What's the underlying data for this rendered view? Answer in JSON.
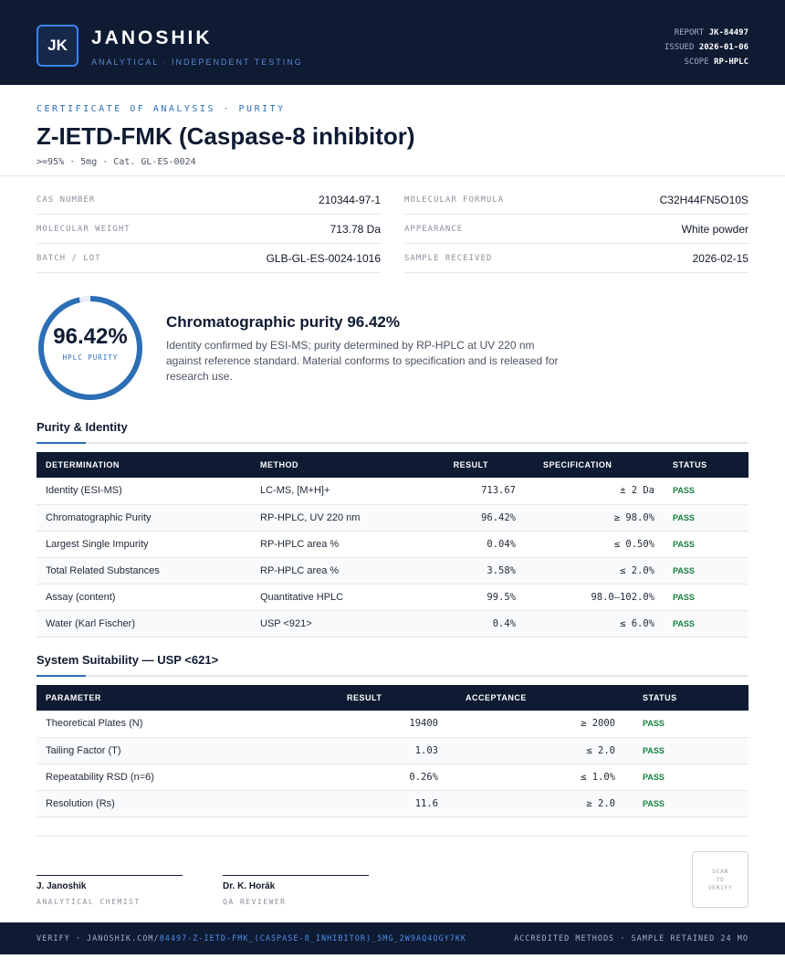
{
  "header": {
    "logo": "JK",
    "brand": "JANOSHIK",
    "tagline": "ANALYTICAL · INDEPENDENT TESTING",
    "report_label": "REPORT",
    "report_value": "JK-84497",
    "issued_label": "ISSUED",
    "issued_value": "2026-01-06",
    "scope_label": "SCOPE",
    "scope_value": "RP-HPLC"
  },
  "doc": {
    "eyebrow": "CERTIFICATE OF ANALYSIS · PURITY",
    "title": "Z-IETD-FMK (Caspase-8 inhibitor)",
    "subline": ">=95% · 5mg  ·  Cat. GL-ES-0024"
  },
  "meta": {
    "cas_label": "CAS NUMBER",
    "cas_value": "210344-97-1",
    "formula_label": "MOLECULAR FORMULA",
    "formula_value": "C32H44FN5O10S",
    "mw_label": "MOLECULAR WEIGHT",
    "mw_value": "713.78 Da",
    "appearance_label": "APPEARANCE",
    "appearance_value": "White powder",
    "batch_label": "BATCH / LOT",
    "batch_value": "GLB-GL-ES-0024-1016",
    "received_label": "SAMPLE RECEIVED",
    "received_value": "2026-02-15"
  },
  "summary": {
    "gauge_value": "96.42%",
    "gauge_fraction": 0.9642,
    "gauge_label": "HPLC PURITY",
    "title": "Chromatographic purity 96.42%",
    "text": "Identity confirmed by ESI-MS; purity determined by RP-HPLC at UV 220 nm against reference standard. Material conforms to specification and is released for research use."
  },
  "purity": {
    "title": "Purity & Identity",
    "headers": [
      "DETERMINATION",
      "METHOD",
      "RESULT",
      "SPECIFICATION",
      "STATUS"
    ],
    "rows": [
      [
        "Identity (ESI-MS)",
        "LC-MS, [M+H]+",
        "713.67",
        "± 2 Da",
        "PASS"
      ],
      [
        "Chromatographic Purity",
        "RP-HPLC, UV 220 nm",
        "96.42%",
        "≥ 98.0%",
        "PASS"
      ],
      [
        "Largest Single Impurity",
        "RP-HPLC area %",
        "0.04%",
        "≤ 0.50%",
        "PASS"
      ],
      [
        "Total Related Substances",
        "RP-HPLC area %",
        "3.58%",
        "≤ 2.0%",
        "PASS"
      ],
      [
        "Assay (content)",
        "Quantitative HPLC",
        "99.5%",
        "98.0–102.0%",
        "PASS"
      ],
      [
        "Water (Karl Fischer)",
        "USP <921>",
        "0.4%",
        "≤ 6.0%",
        "PASS"
      ]
    ]
  },
  "suitability": {
    "title": "System Suitability — USP <621>",
    "headers": [
      "PARAMETER",
      "RESULT",
      "ACCEPTANCE",
      "STATUS"
    ],
    "rows": [
      [
        "Theoretical Plates (N)",
        "19400",
        "≥ 2000",
        "PASS"
      ],
      [
        "Tailing Factor (T)",
        "1.03",
        "≤ 2.0",
        "PASS"
      ],
      [
        "Repeatability RSD (n=6)",
        "0.26%",
        "≤ 1.0%",
        "PASS"
      ],
      [
        "Resolution (Rs)",
        "11.6",
        "≥ 2.0",
        "PASS"
      ]
    ]
  },
  "signatures": {
    "sig1_name": "J. Janoshik",
    "sig1_role": "ANALYTICAL CHEMIST",
    "sig2_name": "Dr. K. Horák",
    "sig2_role": "QA REVIEWER",
    "qr_text": "SCAN TO VERIFY"
  },
  "footer": {
    "verify_prefix": "VERIFY · JANOSHIK.COM/",
    "verify_link": "84497-Z-IETD-FMK_(CASPASE-8_INHIBITOR)_5MG_2W9AQ4QGY7KK",
    "right": "ACCREDITED METHODS · SAMPLE RETAINED 24 MO"
  },
  "colors": {
    "navy": "#0f1b33",
    "accent": "#2c6eb5",
    "pass": "#15803d"
  }
}
